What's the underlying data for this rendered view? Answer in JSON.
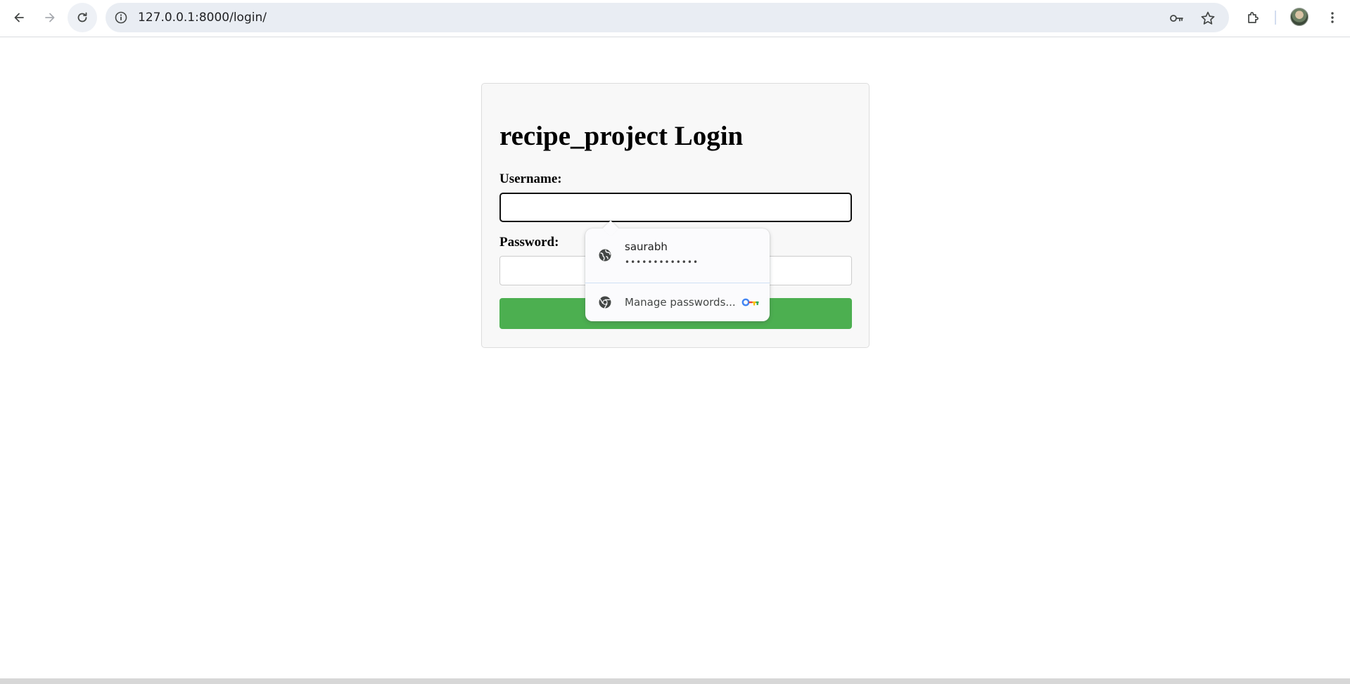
{
  "browser": {
    "url": "127.0.0.1:8000/login/",
    "icons": [
      "back-arrow-icon",
      "forward-arrow-icon",
      "reload-icon",
      "site-info-icon",
      "password-key-icon",
      "bookmark-star-icon",
      "extensions-puzzle-icon",
      "profile-avatar",
      "more-menu-icon"
    ]
  },
  "page": {
    "title": "recipe_project Login",
    "username_label": "Username:",
    "username_value": "",
    "password_label": "Password:",
    "password_value": "",
    "login_button": ""
  },
  "autofill": {
    "username": "saurabh",
    "password_mask": "•••••••••••••",
    "manage_label": "Manage passwords...",
    "icons": [
      "globe-icon",
      "chrome-icon",
      "google-password-key-icon"
    ]
  },
  "colors": {
    "login_button": "#4caf50",
    "omnibox": "#e9edf3",
    "card_background": "#f8f8f8"
  }
}
